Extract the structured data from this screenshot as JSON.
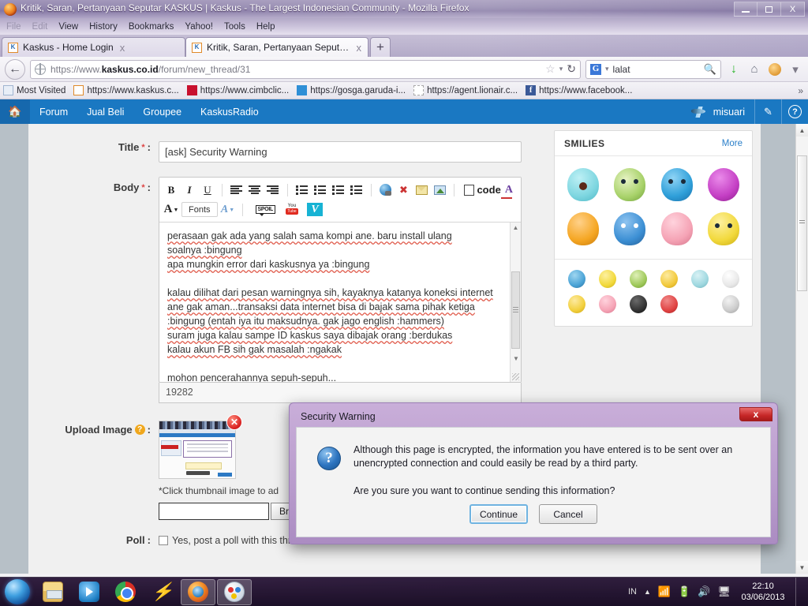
{
  "window": {
    "title": "Kritik, Saran, Pertanyaan Seputar KASKUS | Kaskus - The Largest Indonesian Community - Mozilla Firefox",
    "minimize_label": "Minimize",
    "restore_label": "Restore",
    "close_label": "X"
  },
  "menubar": {
    "items": [
      "File",
      "Edit",
      "View",
      "History",
      "Bookmarks",
      "Yahoo!",
      "Tools",
      "Help"
    ]
  },
  "tabs": [
    {
      "title": "Kaskus - Home Login",
      "favicon": "kaskus-favicon",
      "close": "x",
      "active": false
    },
    {
      "title": "Kritik, Saran, Pertanyaan Seputar KAS...",
      "favicon": "kaskus-favicon",
      "close": "x",
      "active": true
    }
  ],
  "newtab_label": "+",
  "navbar": {
    "back_label": "←",
    "url_prefix": "https://www.",
    "url_domain": "kaskus.co.id",
    "url_path": "/forum/new_thread/31",
    "bookmark_star": "☆",
    "dropdown_caret": "▾",
    "reload": "↻",
    "search_engine": "G",
    "search_value": "lalat",
    "search_placeholder": "Search",
    "download_arrow": "↓",
    "home_icon": "home-icon",
    "menu_caret": "▾"
  },
  "bookmarks": [
    {
      "label": "Most Visited",
      "icon": "most-visited-icon"
    },
    {
      "label": "https://www.kaskus.c...",
      "icon": "kaskus-icon"
    },
    {
      "label": "https://www.cimbclic...",
      "icon": "cimb-icon"
    },
    {
      "label": "https://gosga.garuda-i...",
      "icon": "garuda-icon"
    },
    {
      "label": "https://agent.lionair.c...",
      "icon": "lionair-icon"
    },
    {
      "label": "https://www.facebook...",
      "icon": "facebook-icon"
    }
  ],
  "bookmarks_overflow": "»",
  "kaskus_header": {
    "home_icon": "home-icon",
    "nav": [
      "Forum",
      "Jual Beli",
      "Groupee",
      "KaskusRadio"
    ],
    "username": "misuari",
    "compose_icon": "pencil-icon",
    "help_icon": "question-icon"
  },
  "form": {
    "title_label": "Title",
    "title_required": "*",
    "title_colon": ":",
    "title_value": "[ask] Security Warning",
    "body_label": "Body",
    "body_required": "*",
    "body_colon": ":",
    "body_lines": [
      "perasaan gak ada yang salah sama kompi ane. baru install ulang",
      "soalnya :bingung",
      "apa mungkin error dari kaskusnya ya :bingung",
      "",
      "kalau dilihat dari pesan warningnya sih, kayaknya katanya koneksi internet",
      "ane gak aman...transaksi data internet bisa di bajak sama pihak ketiga",
      ":bingung (entah iya itu maksudnya. gak jago english :hammers)",
      "suram juga kalau sampe ID kaskus saya dibajak orang :berdukas",
      "kalau akun FB sih gak masalah :ngakak",
      "",
      "mohon pencerahannya sepuh-sepuh..."
    ],
    "char_count": "19282",
    "upload_label": "Upload Image",
    "upload_help": "?",
    "upload_colon": ":",
    "thumbnail_delete": "✕",
    "thumbnail_note": "*Click thumbnail image to ad",
    "file_value": "",
    "browse_label": "Br",
    "poll_label": "Poll",
    "poll_colon": ":",
    "poll_option": "Yes, post a poll with this thread"
  },
  "toolbar": {
    "row1": [
      "B",
      "I",
      "U",
      "align-left",
      "align-center",
      "align-right",
      "bullet-list",
      "numbered-list",
      "indent",
      "outdent",
      "insert-link",
      "remove-link",
      "insert-email",
      "insert-image",
      "quote",
      "code",
      "color"
    ],
    "row2": [
      "font-size",
      "Fonts",
      "font-color",
      "SPOIL",
      "YouTube",
      "Vimeo"
    ],
    "fonts_label": "Fonts",
    "spoil_label": "SPOIL",
    "youtube_top": "You",
    "youtube_bottom": "Tube",
    "vimeo_label": "V"
  },
  "smilies": {
    "title": "SMILIES",
    "more_label": "More",
    "row_large": [
      {
        "name": "shock-smiley",
        "color": "#7ed6e0"
      },
      {
        "name": "matabelo-smiley",
        "color": "#a8d26a"
      },
      {
        "name": "mewek-smiley",
        "color": "#2f9fd9"
      },
      {
        "name": "bingung-smiley",
        "color": "#c43fc4"
      },
      {
        "name": "ngakak-smiley",
        "color": "#f5a623"
      },
      {
        "name": "berduka-smiley",
        "color": "#3c8fd4"
      },
      {
        "name": "malu-smiley",
        "color": "#f5a3b5"
      },
      {
        "name": "hammer-smiley",
        "color": "#f2d93c"
      }
    ],
    "row_small": [
      {
        "name": "kiss-smiley",
        "color": "#4aa3d6"
      },
      {
        "name": "confused-smiley",
        "color": "#f2d93c"
      },
      {
        "name": "angel-smiley",
        "color": "#9fc95a"
      },
      {
        "name": "wink-smiley",
        "color": "#f2c93c"
      },
      {
        "name": "sleep-smiley",
        "color": "#9fd8e0"
      },
      {
        "name": "flag-smiley",
        "color": "#e8e8e8"
      },
      {
        "name": "cendol-smiley",
        "color": "#f2cf3c"
      },
      {
        "name": "pink-smiley",
        "color": "#f5a3b5"
      },
      {
        "name": "bata-smiley",
        "color": "#2a2a2a"
      },
      {
        "name": "marah-smiley",
        "color": "#e04343"
      },
      {
        "name": "blank-smiley",
        "color": "transparent"
      },
      {
        "name": "hammer2-smiley",
        "color": "#cccccc"
      }
    ]
  },
  "dialog": {
    "title": "Security Warning",
    "close_label": "x",
    "icon": "question-icon",
    "message": "Although this page is encrypted, the information you have entered is to be sent over an unencrypted connection and could easily be read by a third party.",
    "question": "Are you sure you want to continue sending this information?",
    "continue_label": "Continue",
    "cancel_label": "Cancel"
  },
  "taskbar": {
    "start_label": "start-orb",
    "items": [
      {
        "name": "windows-explorer",
        "icon": "explorer-icon"
      },
      {
        "name": "windows-media-player",
        "icon": "wmp-icon"
      },
      {
        "name": "google-chrome",
        "icon": "chrome-icon"
      },
      {
        "name": "bolt-app",
        "icon": "bolt-icon"
      },
      {
        "name": "mozilla-firefox",
        "icon": "firefox-icon",
        "active": true
      },
      {
        "name": "paint",
        "icon": "paint-icon",
        "active": true
      }
    ],
    "tray": {
      "language": "IN",
      "expand": "▲",
      "network_icon": "network-error-icon",
      "battery_icon": "battery-icon",
      "volume_icon": "volume-icon",
      "monitor_icon": "monitor-icon"
    },
    "clock_time": "22:10",
    "clock_date": "03/06/2013"
  },
  "colors": {
    "kaskus_blue": "#1a78c2",
    "dialog_purple": "#b89bcc",
    "accent_red": "#d81f1f",
    "link_blue": "#2a7fc9"
  }
}
